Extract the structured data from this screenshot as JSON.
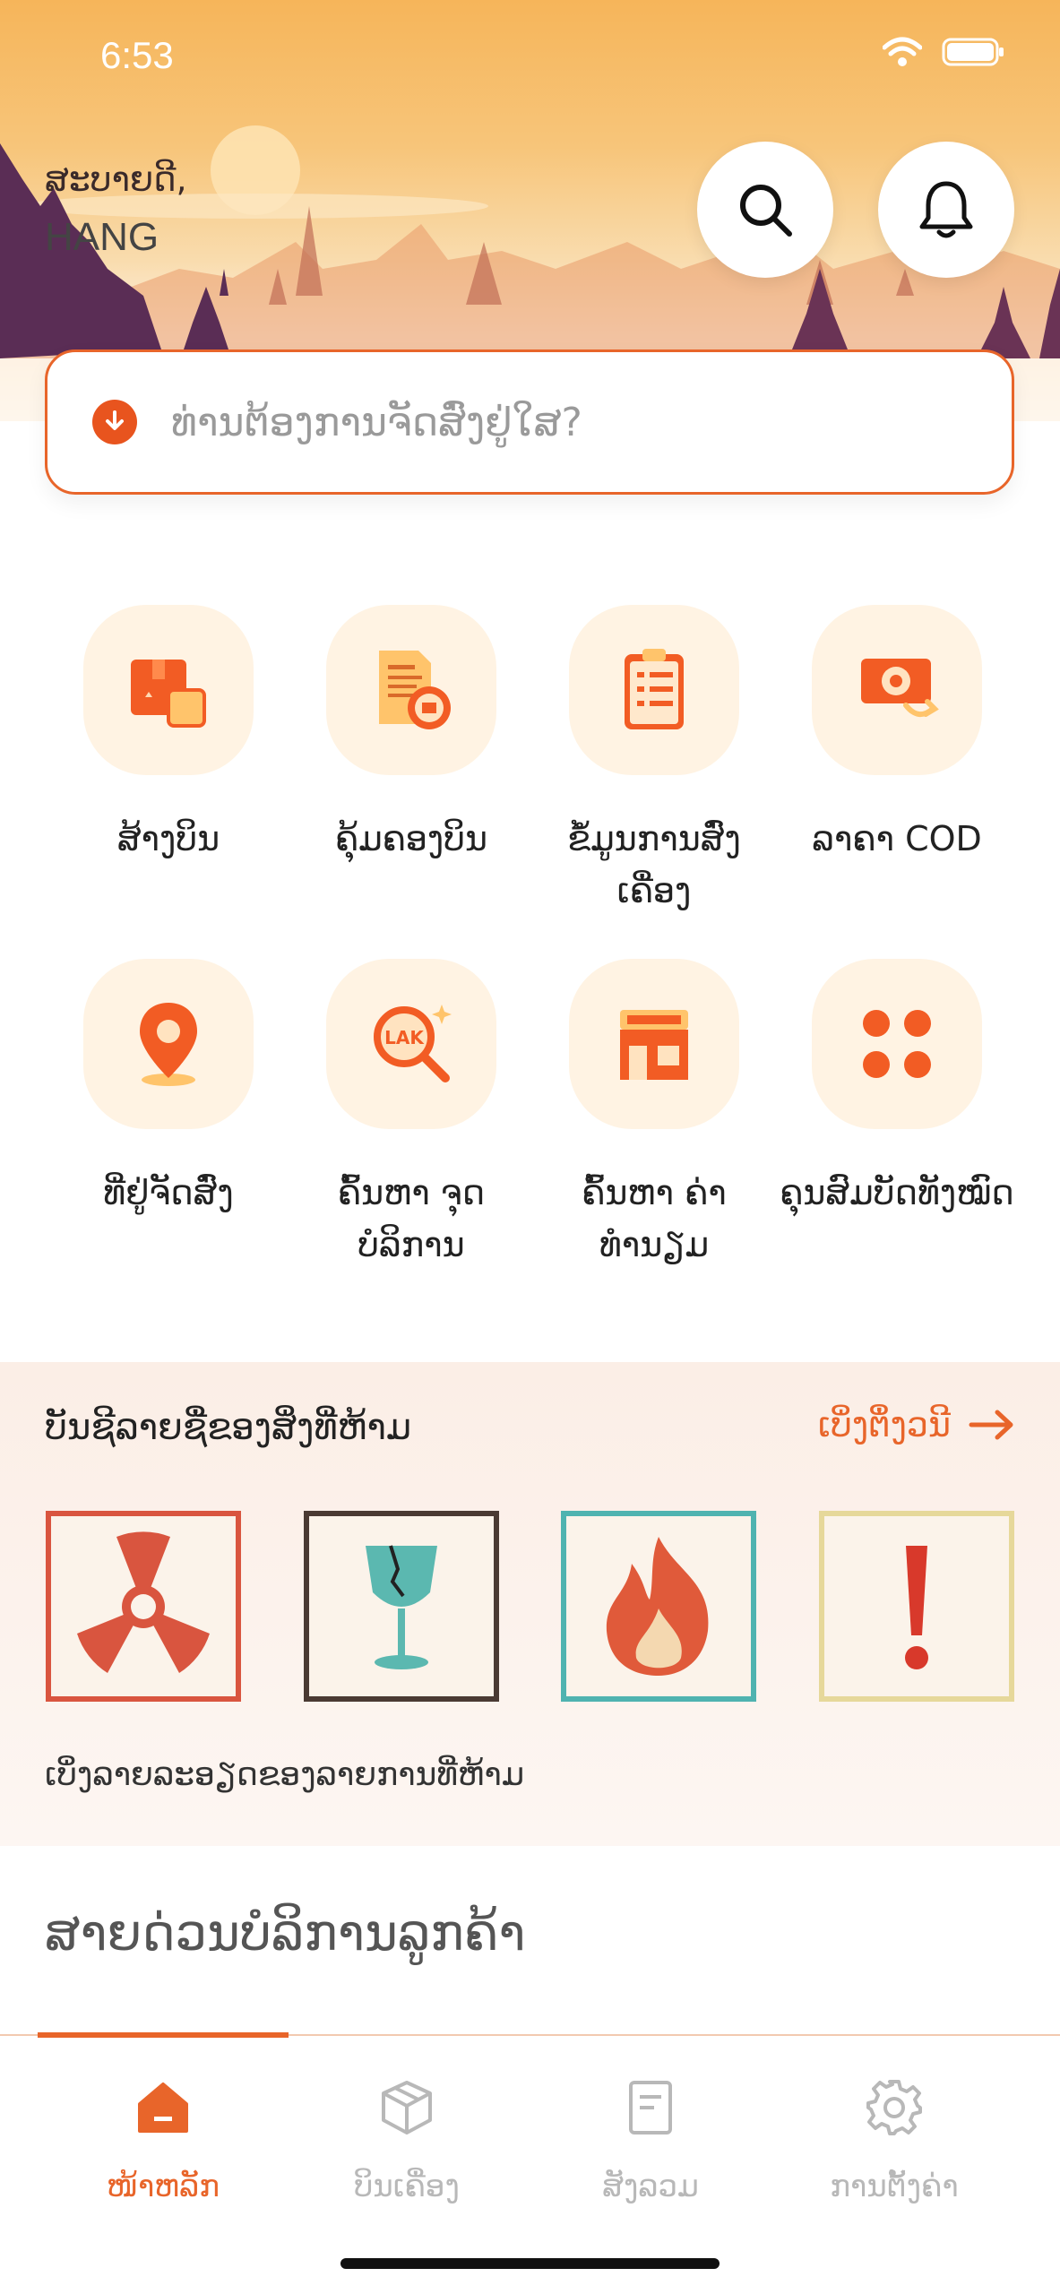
{
  "status_bar": {
    "time": "6:53",
    "icons": [
      "wifi-icon",
      "battery-icon"
    ]
  },
  "header": {
    "greeting": "ສະບາຍດີ,",
    "user_name": "HANG",
    "search_button_icon": "search-icon",
    "notification_button_icon": "bell-icon"
  },
  "search": {
    "placeholder": "ທ່ານຕ້ອງການຈັດສົ່ງຢູ່ໃສ?",
    "icon": "download-circle-icon"
  },
  "services": [
    {
      "label": "ສ້າງບິນ",
      "icon": "package-icon"
    },
    {
      "label": "ຄຸ້ມຄອງບິນ",
      "icon": "bill-manage-icon"
    },
    {
      "label": "ຂໍ້ມູນການສົ່ງເຄື່ອງ",
      "icon": "clipboard-icon"
    },
    {
      "label": "ລາຄາ COD",
      "icon": "cash-icon"
    },
    {
      "label": "ທີ່ຢູ່ຈັດສົ່ງ",
      "icon": "location-pin-icon"
    },
    {
      "label": "ຄົ້ນຫາ ຈຸດບໍລິການ",
      "icon": "lak-search-icon"
    },
    {
      "label": "ຄົ້ນຫາ ຄ່າທຳນຽມ",
      "icon": "store-icon"
    },
    {
      "label": "ຄຸນສົມບັດທັງໝົດ",
      "icon": "grid-icon"
    }
  ],
  "prohibited": {
    "title": "ບັນຊີລາຍຊື່ຂອງສິ່ງທີ່ຫ້າມ",
    "see_more": "ເບິ່ງຕຶ່ງວນີ",
    "items": [
      "radiation-icon",
      "broken-glass-icon",
      "fire-icon",
      "exclamation-icon"
    ],
    "description": "ເບິ່ງລາຍລະອຽດຂອງລາຍການທີ່ຫ້າມ"
  },
  "hotline": {
    "title": "ສາຍດ່ວນບໍລິການລູກຄ້າ"
  },
  "tabbar": {
    "tabs": [
      {
        "label": "ໜ້າຫລັກ",
        "icon": "home-icon",
        "active": true
      },
      {
        "label": "ບິນເຄື່ອງ",
        "icon": "box-icon",
        "active": false
      },
      {
        "label": "ສັງລວມ",
        "icon": "document-icon",
        "active": false
      },
      {
        "label": "ການຕັ້ງຄ່າ",
        "icon": "gear-icon",
        "active": false
      }
    ]
  },
  "colors": {
    "accent": "#e8652a",
    "tile_bg": "#fff3e3",
    "inactive": "#b8b8b8"
  }
}
